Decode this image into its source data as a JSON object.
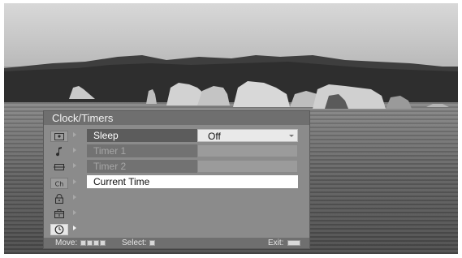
{
  "menu": {
    "title": "Clock/Timers",
    "category_icons": [
      {
        "name": "picture-icon",
        "glyph": "▣",
        "active": false
      },
      {
        "name": "sound-icon",
        "glyph": "♪",
        "active": false
      },
      {
        "name": "screen-icon",
        "glyph": "⊖",
        "active": false
      },
      {
        "name": "channel-icon",
        "glyph": "Ch",
        "active": false
      },
      {
        "name": "parental-lock-icon",
        "glyph": "⊕",
        "active": false
      },
      {
        "name": "setup-icon",
        "glyph": "⊟",
        "active": false
      },
      {
        "name": "clock-icon",
        "glyph": "⊙",
        "active": true
      }
    ],
    "items": [
      {
        "label": "Sleep",
        "value": "Off",
        "state": "selected"
      },
      {
        "label": "Timer 1",
        "value": "",
        "state": "disabled"
      },
      {
        "label": "Timer 2",
        "value": "",
        "state": "disabled"
      },
      {
        "label": "Current Time",
        "value": "",
        "state": "full"
      }
    ]
  },
  "footer": {
    "move_label": "Move:",
    "select_label": "Select:",
    "exit_label": "Exit:"
  }
}
